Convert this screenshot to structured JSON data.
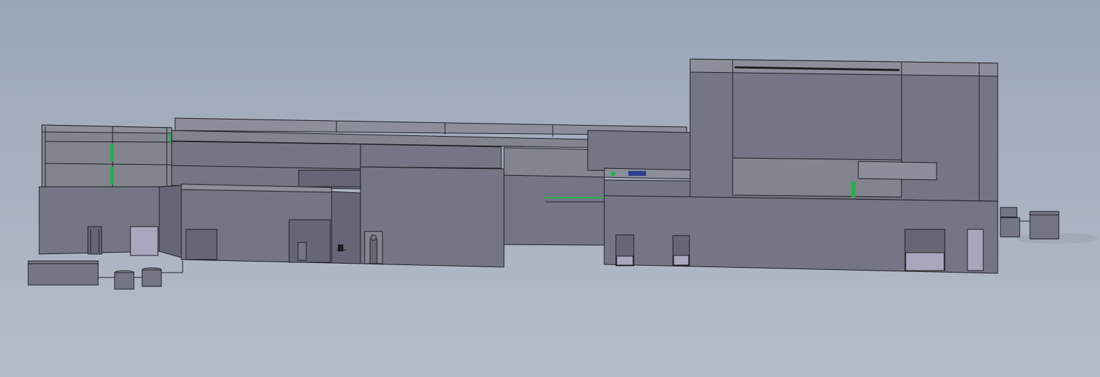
{
  "scene": {
    "kind": "cad-3d-model-view",
    "colors": {
      "background_top": "#9aa6b8",
      "background_bottom": "#b6bccb",
      "wall": "#747685",
      "wall_dark": "#656776",
      "wall_light": "#82848f",
      "panel_light": "#a7a8bd",
      "roof_strip": "#8c8e9b",
      "edge": "#1c1c22",
      "accent_green": "#22b14c",
      "accent_blue": "#2f3f8f",
      "shadow": "#8f97a6"
    }
  }
}
